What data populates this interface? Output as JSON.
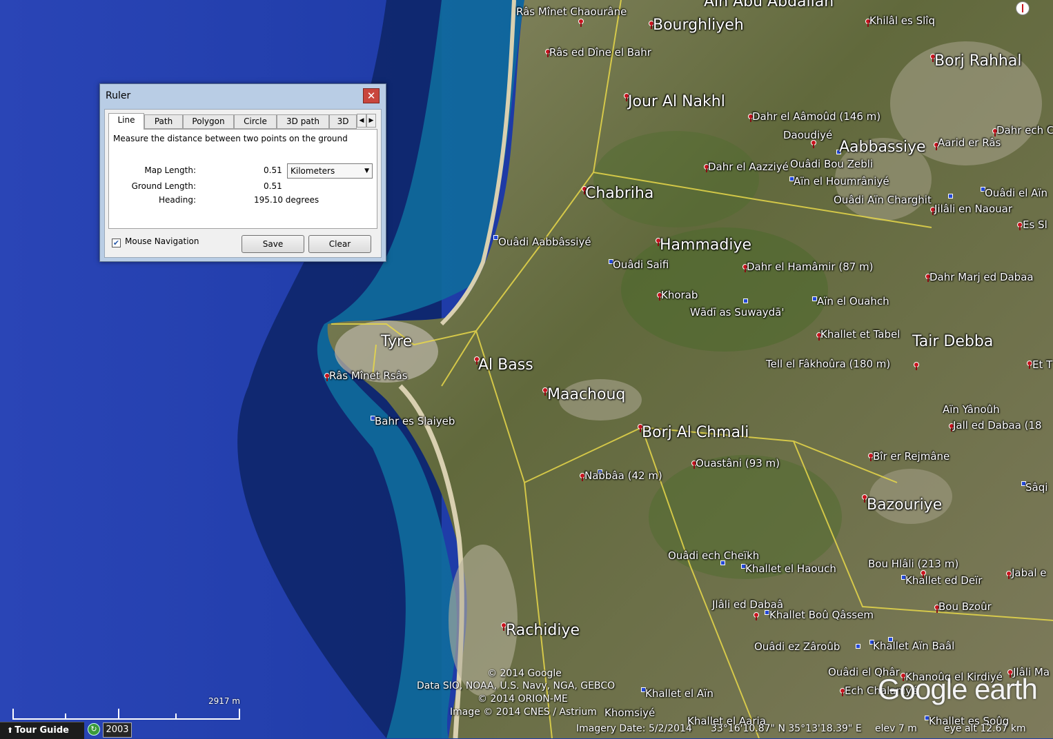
{
  "ruler": {
    "title": "Ruler",
    "close_icon": "close-icon",
    "tabs": [
      "Line",
      "Path",
      "Polygon",
      "Circle",
      "3D path",
      "3D"
    ],
    "active_tab": "Line",
    "description": "Measure the distance between two points on the ground",
    "map_length_label": "Map Length:",
    "map_length_value": "0.51",
    "units": "Kilometers",
    "ground_length_label": "Ground Length:",
    "ground_length_value": "0.51",
    "heading_label": "Heading:",
    "heading_value": "195.10 degrees",
    "mouse_navigation_label": "Mouse Navigation",
    "mouse_navigation_checked": true,
    "save_label": "Save",
    "clear_label": "Clear"
  },
  "places": {
    "ain_abu_abdallah": "Aïn Abu Abdallah",
    "ras_minet_chaourane": "Râs Mînet Chaourâne",
    "bourghliyeh": "Bourghliyeh",
    "khilal_es_sliq": "Khilâl es Slîq",
    "ras_ed_dine": "Râs ed Dîne el Bahr",
    "borj_rahhal": "Borj Rahhal",
    "jour_al_nakhl": "Jour Al Nakhl",
    "dahr_el_aamoud": "Dahr el Aâmoûd (146 m)",
    "daoudiye": "Daoudiyé",
    "dahr_ech": "Dahr ech C",
    "aabbassiye": "Aabbassiye",
    "aarid_er_ras": "Aarid er Râs",
    "dahr_el_aazziye": "Dahr el Aazziyé",
    "ouadi_bou_zebli": "Ouâdi Bou Zebli",
    "ain_el_houmraniye": "Aïn el Houmrâniyé",
    "chabriha": "Chabriha",
    "ouadi_ain_charghit": "Ouâdi Aïn Charghit",
    "ouadi_el_ain": "Ouâdi el Aïn",
    "jilali_en_naouar": "Jilâli en Naouar",
    "es_sl": "Es Sl",
    "ouadi_aabbassiye": "Ouâdi Aabbâssiyé",
    "hammadiye": "Hammadiye",
    "ouadi_saifi": "Ouâdi Saifi",
    "dahr_el_hamamir": "Dahr el Hamâmir (87 m)",
    "dahr_marj_ed_dabaa": "Dahr Marj ed Dabaa",
    "khorab": "Khorab",
    "ain_el_ouahch": "Aïn el Ouahch",
    "wadi_as_suwayda": "Wādī as Suwaydā'",
    "khallet_et_tabel": "Khallet et Tabel",
    "tair_debba": "Tair Debba",
    "tyre": "Tyre",
    "al_bass": "Al Bass",
    "ras_minet_rsas": "Râs Mînet Rsâs",
    "tell_el_fakhoura": "Tell el Fâkhoûra (180 m)",
    "et_t": "Et T",
    "maachouq": "Maachouq",
    "bahr_es_slaiyeb": "Bahr es Slaiyeb",
    "ain_yanouh": "Aïn Yânoûh",
    "jall_ed_dabaa": "Jall ed Dabaa (18",
    "borj_al_chmali": "Borj Al Chmali",
    "bir_er_rejmane": "Bîr er Rejmâne",
    "ouastani": "Ouastâni (93 m)",
    "nabbaa": "Nabbâa (42 m)",
    "saqi": "Sâqi",
    "bazouriye": "Bazouriye",
    "ouadi_ech_cheikh": "Ouâdi ech Cheïkh",
    "khallet_el_haouch": "Khallet el Haouch",
    "bou_hlali": "Bou Hlâli (213 m)",
    "jabal_e": "Jabal e",
    "khallet_ed_deir": "Khallet ed Deïr",
    "jlali_ed_dabaa": "Jlâli ed Dabaâ",
    "bou_bzour": "Bou Bzoûr",
    "khallet_bou_qassem": "Khallet Boû Qâssem",
    "rachidiye": "Rachidiye",
    "ouadi_ez_zaroub": "Ouâdi ez Zâroûb",
    "khallet_ain_baal": "Khallet Aïn Baâl",
    "ouadi_el_qhar": "Ouâdi el Qhâr",
    "khanouq_el_kirdiye": "Khanoûq el Kirdiyé",
    "jlali_ma": "Jlâli Ma",
    "ech_chalaniye": "Ech Chalaniyé",
    "khallet_el_ain": "Khallet el Aïn",
    "khomsiye": "Khomsiyé",
    "khallet_el_aaria": "Khallet el Aaria",
    "khallet_es_soug": "Khallet es Soûg"
  },
  "credits": {
    "line1": "© 2014 Google",
    "line2": "Data SIO, NOAA, U.S. Navy, NGA, GEBCO",
    "line3": "© 2014 ORION-ME",
    "line4": "Image © 2014 CNES / Astrium"
  },
  "logo": {
    "text1": "Google",
    "text2": " earth"
  },
  "scale": {
    "label": "2917 m"
  },
  "statusbar": {
    "tour_guide": "Tour Guide",
    "history_icon": "clock-icon",
    "year": "2003",
    "imagery_date": "Imagery Date: 5/2/2014",
    "coords": "33°16'10.87\" N  35°13'18.39\" E",
    "elev": "elev     7 m",
    "eye_alt": "eye alt  12.67 km"
  },
  "colors": {
    "sea_deep": "#1f3fa6",
    "land": "#6d7446",
    "road": "#e8d84a",
    "pin": "#c8141e",
    "dialog": "#b9cde5"
  }
}
